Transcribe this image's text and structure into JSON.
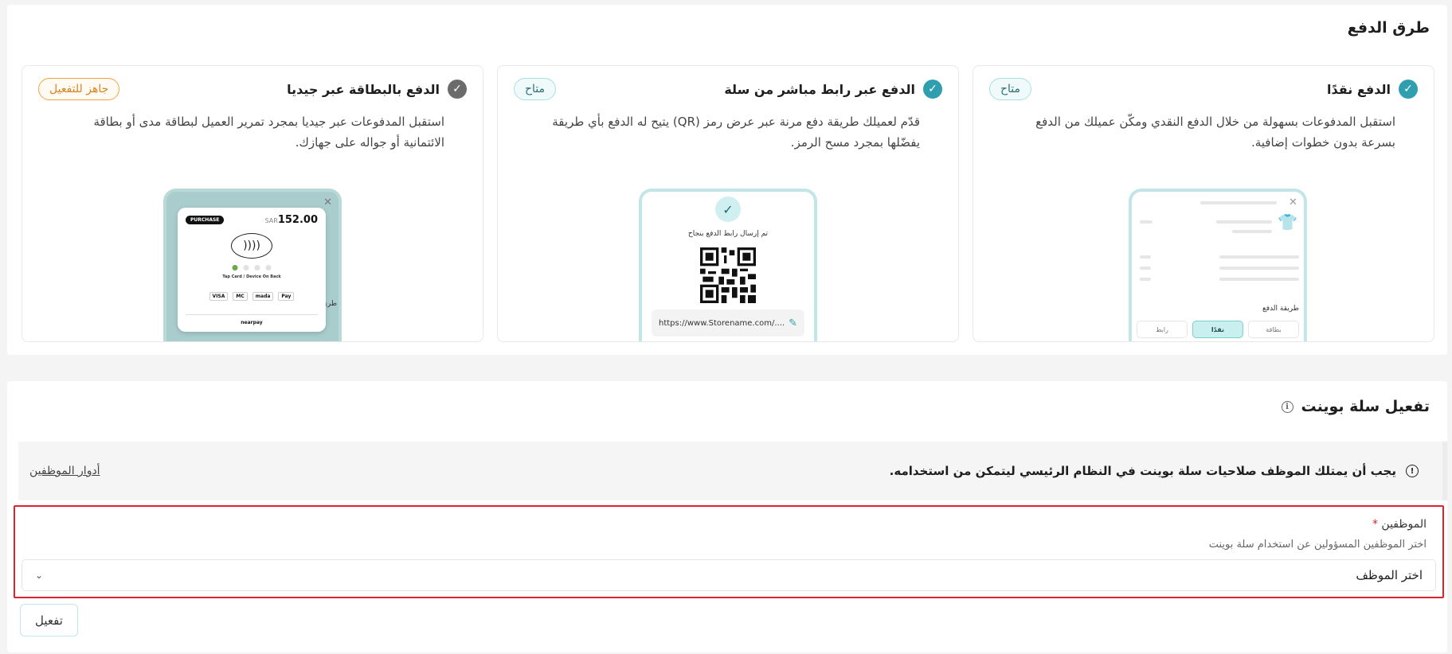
{
  "payment_methods": {
    "title": "طرق الدفع",
    "cards": [
      {
        "title": "الدفع نقدًا",
        "badge": "متاح",
        "description": "استقبل المدفوعات بسهولة من خلال الدفع النقدي ومكّن عميلك من الدفع بسرعة بدون خطوات إضافية.",
        "mock": {
          "section_label": "طريقة الدفع",
          "options": [
            "بطاقة",
            "نقدًا",
            "رابط"
          ]
        }
      },
      {
        "title": "الدفع عبر رابط مباشر من سلة",
        "badge": "متاح",
        "description": "قدّم لعميلك طريقة دفع مرنة عبر عرض رمز (QR) يتيح له الدفع بأي طريقة يفضّلها بمجرد مسح الرمز.",
        "mock": {
          "success_text": "تم إرسال رابط الدفع بنجاح",
          "link": "https://www.Storename.com/...."
        }
      },
      {
        "title": "الدفع بالبطاقة عبر جيديا",
        "badge": "جاهز للتفعيل",
        "description": "استقبل المدفوعات عبر جيديا بمجرد تمرير العميل لبطاقة مدى أو بطاقة الائتمانية أو جواله على جهازك.",
        "mock": {
          "tag": "PURCHASE",
          "currency": "SAR",
          "amount": "152.00",
          "tap_text": "Tap Card / Device On Back",
          "brands": [
            "VISA",
            "MC",
            "mada",
            "Pay"
          ],
          "powered": "nearpay",
          "side_label": "طري"
        }
      }
    ]
  },
  "point": {
    "title": "تفعيل سلة بوينت",
    "alert_text": "يجب أن يمتلك الموظف صلاحيات سلة بوينت في النظام الرئيسي ليتمكن من استخدامه.",
    "alert_link": "أدوار الموظفين",
    "field_label": "الموظفين",
    "required_mark": "*",
    "field_help": "اختر الموظفين المسؤولين عن استخدام سلة بوينت",
    "select_placeholder": "اختر الموظف",
    "activate_label": "تفعيل"
  },
  "icons": {
    "check": "✓",
    "close": "✕",
    "chevron": "⌄",
    "info": "i",
    "alert": "!",
    "nfc": "))))",
    "edit": "✎",
    "shirt": "👕"
  },
  "colors": {
    "accent": "#2f9fb0",
    "badge_available": "#a9e0e3",
    "badge_ready": "#f3a445",
    "error_border": "#e0222a"
  }
}
